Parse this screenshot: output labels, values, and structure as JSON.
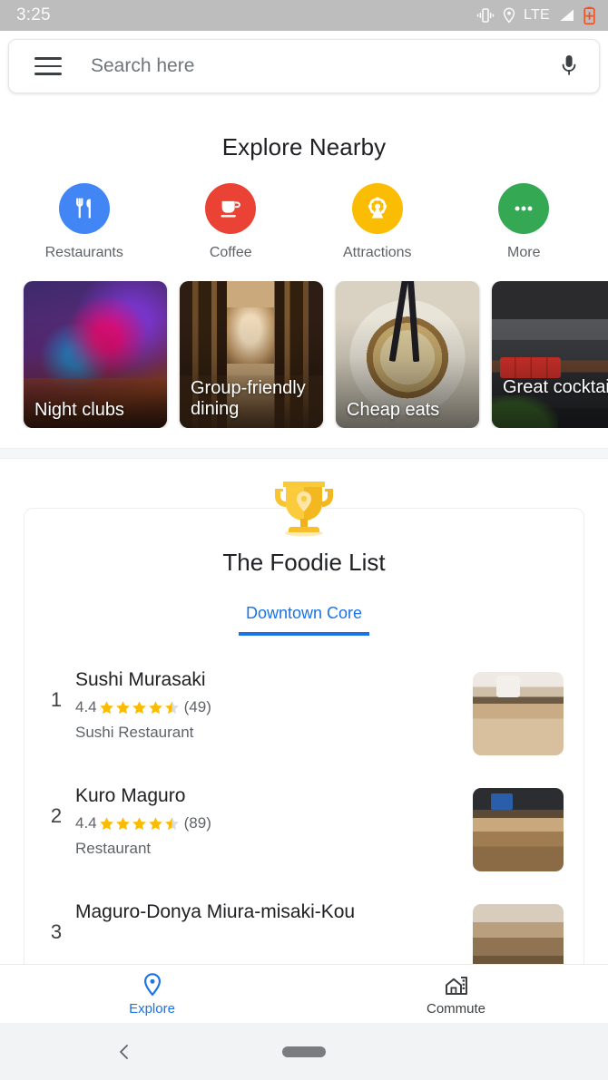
{
  "status_bar": {
    "time": "3:25",
    "icons": [
      "vibrate-icon",
      "location-icon",
      "lte-label",
      "signal-icon",
      "battery-charging-icon"
    ],
    "network_label": "LTE",
    "background_color": "#bdbdbd"
  },
  "search": {
    "placeholder": "Search here",
    "menu_icon": "hamburger-menu-icon",
    "voice_icon": "microphone-icon"
  },
  "explore": {
    "title": "Explore Nearby",
    "categories": [
      {
        "label": "Restaurants",
        "icon": "restaurant-icon",
        "color": "#4285f4"
      },
      {
        "label": "Coffee",
        "icon": "coffee-cup-icon",
        "color": "#ea4335"
      },
      {
        "label": "Attractions",
        "icon": "ferris-wheel-icon",
        "color": "#fbbc04"
      },
      {
        "label": "More",
        "icon": "more-dots-icon",
        "color": "#34a853"
      }
    ],
    "cards": [
      {
        "label": "Night clubs",
        "image": "nightlife-photo"
      },
      {
        "label": "Group-friendly dining",
        "image": "wine-cellar-photo"
      },
      {
        "label": "Cheap eats",
        "image": "noodle-bowl-photo"
      },
      {
        "label": "Great cocktails",
        "image": "bar-interior-photo"
      }
    ]
  },
  "foodie_list": {
    "badge_icon": "trophy-icon",
    "title": "The Foodie List",
    "tab": "Downtown Core",
    "tab_color": "#1a73e8",
    "items": [
      {
        "rank": "1",
        "name": "Sushi Murasaki",
        "rating": "4.4",
        "stars": 4.5,
        "review_count": "(49)",
        "type": "Sushi Restaurant",
        "thumbnail": "sushi-counter-photo"
      },
      {
        "rank": "2",
        "name": "Kuro Maguro",
        "rating": "4.4",
        "stars": 4.5,
        "review_count": "(89)",
        "type": "Restaurant",
        "thumbnail": "restaurant-interior-photo"
      },
      {
        "rank": "3",
        "name": "Maguro-Donya Miura-misaki-Kou",
        "rating": "",
        "stars": 0,
        "review_count": "",
        "type": "",
        "thumbnail": "restaurant-hall-photo"
      }
    ]
  },
  "bottom_nav": {
    "items": [
      {
        "label": "Explore",
        "icon": "location-pin-icon",
        "active": true
      },
      {
        "label": "Commute",
        "icon": "building-icon",
        "active": false
      }
    ]
  },
  "system_nav": {
    "back_icon": "back-chevron-icon",
    "home_pill": "home-gesture-pill"
  }
}
